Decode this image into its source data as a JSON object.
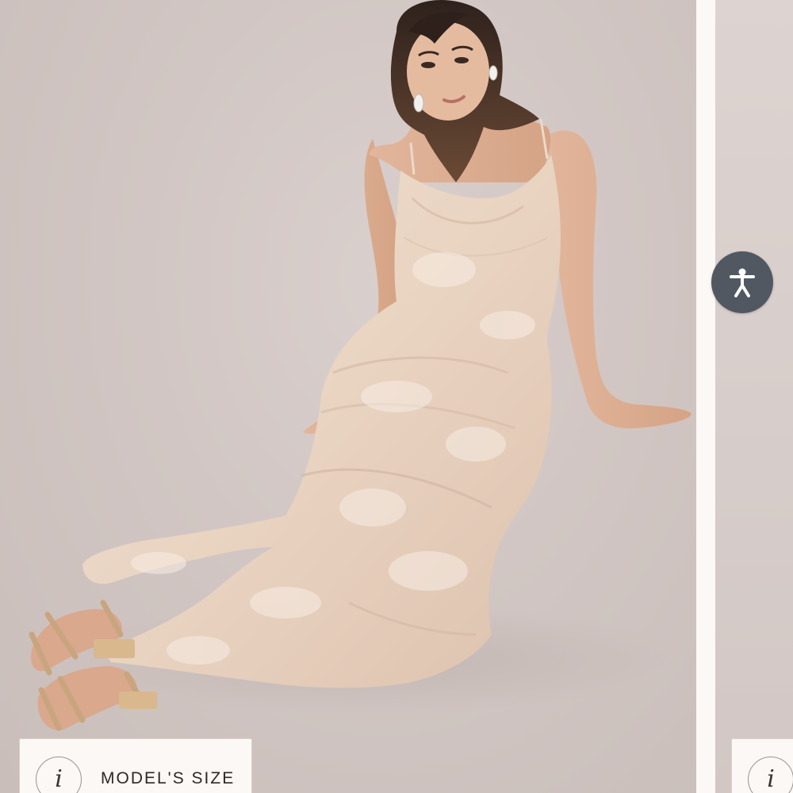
{
  "gallery": {
    "main_image": {
      "alt": "Model in a blush floral satin cowl-neck slip dress sitting on the floor"
    },
    "model_size_badge": {
      "icon": "info-icon",
      "icon_glyph": "i",
      "label": "MODEL'S SIZE"
    },
    "next_badge": {
      "icon": "info-icon",
      "icon_glyph": "i"
    }
  },
  "accessibility": {
    "icon": "accessibility-icon",
    "color": "#515861"
  },
  "colors": {
    "backdrop": "#d1c6c3",
    "dress": "#ecd9c8",
    "page_background": "#fbf8f5"
  }
}
